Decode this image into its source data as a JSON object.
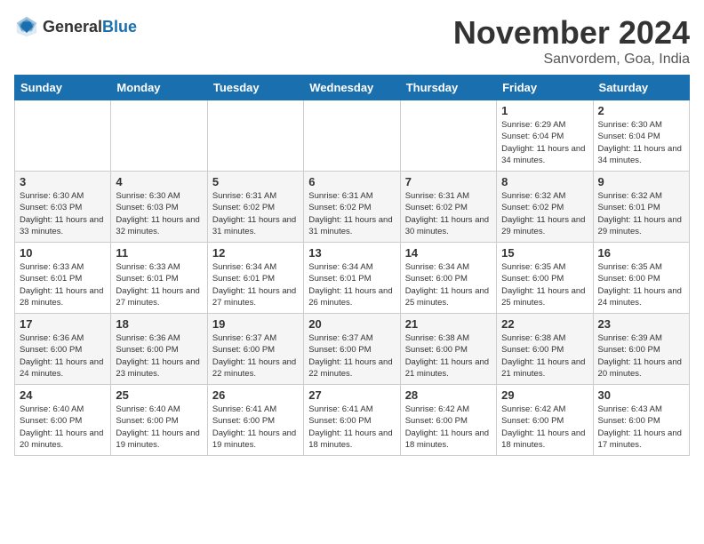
{
  "logo": {
    "text_general": "General",
    "text_blue": "Blue"
  },
  "title": "November 2024",
  "subtitle": "Sanvordem, Goa, India",
  "days_of_week": [
    "Sunday",
    "Monday",
    "Tuesday",
    "Wednesday",
    "Thursday",
    "Friday",
    "Saturday"
  ],
  "weeks": [
    [
      {
        "day": "",
        "detail": ""
      },
      {
        "day": "",
        "detail": ""
      },
      {
        "day": "",
        "detail": ""
      },
      {
        "day": "",
        "detail": ""
      },
      {
        "day": "",
        "detail": ""
      },
      {
        "day": "1",
        "detail": "Sunrise: 6:29 AM\nSunset: 6:04 PM\nDaylight: 11 hours and 34 minutes."
      },
      {
        "day": "2",
        "detail": "Sunrise: 6:30 AM\nSunset: 6:04 PM\nDaylight: 11 hours and 34 minutes."
      }
    ],
    [
      {
        "day": "3",
        "detail": "Sunrise: 6:30 AM\nSunset: 6:03 PM\nDaylight: 11 hours and 33 minutes."
      },
      {
        "day": "4",
        "detail": "Sunrise: 6:30 AM\nSunset: 6:03 PM\nDaylight: 11 hours and 32 minutes."
      },
      {
        "day": "5",
        "detail": "Sunrise: 6:31 AM\nSunset: 6:02 PM\nDaylight: 11 hours and 31 minutes."
      },
      {
        "day": "6",
        "detail": "Sunrise: 6:31 AM\nSunset: 6:02 PM\nDaylight: 11 hours and 31 minutes."
      },
      {
        "day": "7",
        "detail": "Sunrise: 6:31 AM\nSunset: 6:02 PM\nDaylight: 11 hours and 30 minutes."
      },
      {
        "day": "8",
        "detail": "Sunrise: 6:32 AM\nSunset: 6:02 PM\nDaylight: 11 hours and 29 minutes."
      },
      {
        "day": "9",
        "detail": "Sunrise: 6:32 AM\nSunset: 6:01 PM\nDaylight: 11 hours and 29 minutes."
      }
    ],
    [
      {
        "day": "10",
        "detail": "Sunrise: 6:33 AM\nSunset: 6:01 PM\nDaylight: 11 hours and 28 minutes."
      },
      {
        "day": "11",
        "detail": "Sunrise: 6:33 AM\nSunset: 6:01 PM\nDaylight: 11 hours and 27 minutes."
      },
      {
        "day": "12",
        "detail": "Sunrise: 6:34 AM\nSunset: 6:01 PM\nDaylight: 11 hours and 27 minutes."
      },
      {
        "day": "13",
        "detail": "Sunrise: 6:34 AM\nSunset: 6:01 PM\nDaylight: 11 hours and 26 minutes."
      },
      {
        "day": "14",
        "detail": "Sunrise: 6:34 AM\nSunset: 6:00 PM\nDaylight: 11 hours and 25 minutes."
      },
      {
        "day": "15",
        "detail": "Sunrise: 6:35 AM\nSunset: 6:00 PM\nDaylight: 11 hours and 25 minutes."
      },
      {
        "day": "16",
        "detail": "Sunrise: 6:35 AM\nSunset: 6:00 PM\nDaylight: 11 hours and 24 minutes."
      }
    ],
    [
      {
        "day": "17",
        "detail": "Sunrise: 6:36 AM\nSunset: 6:00 PM\nDaylight: 11 hours and 24 minutes."
      },
      {
        "day": "18",
        "detail": "Sunrise: 6:36 AM\nSunset: 6:00 PM\nDaylight: 11 hours and 23 minutes."
      },
      {
        "day": "19",
        "detail": "Sunrise: 6:37 AM\nSunset: 6:00 PM\nDaylight: 11 hours and 22 minutes."
      },
      {
        "day": "20",
        "detail": "Sunrise: 6:37 AM\nSunset: 6:00 PM\nDaylight: 11 hours and 22 minutes."
      },
      {
        "day": "21",
        "detail": "Sunrise: 6:38 AM\nSunset: 6:00 PM\nDaylight: 11 hours and 21 minutes."
      },
      {
        "day": "22",
        "detail": "Sunrise: 6:38 AM\nSunset: 6:00 PM\nDaylight: 11 hours and 21 minutes."
      },
      {
        "day": "23",
        "detail": "Sunrise: 6:39 AM\nSunset: 6:00 PM\nDaylight: 11 hours and 20 minutes."
      }
    ],
    [
      {
        "day": "24",
        "detail": "Sunrise: 6:40 AM\nSunset: 6:00 PM\nDaylight: 11 hours and 20 minutes."
      },
      {
        "day": "25",
        "detail": "Sunrise: 6:40 AM\nSunset: 6:00 PM\nDaylight: 11 hours and 19 minutes."
      },
      {
        "day": "26",
        "detail": "Sunrise: 6:41 AM\nSunset: 6:00 PM\nDaylight: 11 hours and 19 minutes."
      },
      {
        "day": "27",
        "detail": "Sunrise: 6:41 AM\nSunset: 6:00 PM\nDaylight: 11 hours and 18 minutes."
      },
      {
        "day": "28",
        "detail": "Sunrise: 6:42 AM\nSunset: 6:00 PM\nDaylight: 11 hours and 18 minutes."
      },
      {
        "day": "29",
        "detail": "Sunrise: 6:42 AM\nSunset: 6:00 PM\nDaylight: 11 hours and 18 minutes."
      },
      {
        "day": "30",
        "detail": "Sunrise: 6:43 AM\nSunset: 6:00 PM\nDaylight: 11 hours and 17 minutes."
      }
    ]
  ]
}
